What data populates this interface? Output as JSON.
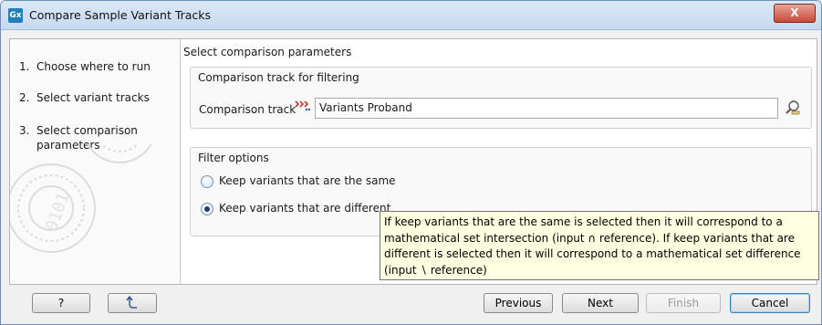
{
  "window": {
    "app_icon_text": "Gx",
    "title": "Compare Sample Variant Tracks",
    "close_symbol": "X"
  },
  "steps": [
    {
      "num": "1.",
      "label": "Choose where to run"
    },
    {
      "num": "2.",
      "label": "Select variant tracks"
    },
    {
      "num": "3.",
      "label": "Select comparison parameters"
    }
  ],
  "content": {
    "section_title": "Select comparison parameters",
    "comparison_group": {
      "title": "Comparison track for filtering",
      "track_label": "Comparison track",
      "track_value": "Variants Proband",
      "track_icon": "variant-track-icon",
      "browse_icon": "browse-magnifier-icon"
    },
    "filter_group": {
      "title": "Filter options",
      "options": [
        {
          "label": "Keep variants that are the same",
          "checked": false
        },
        {
          "label": "Keep variants that are different",
          "checked": true
        }
      ]
    },
    "tooltip_lines": [
      "If keep variants that are the same is selected then it will correspond to a",
      "mathematical set intersection (input ∩ reference). If keep variants that are",
      "different is selected then it will correspond to a mathematical set difference",
      "(input ∖ reference)"
    ]
  },
  "footer": {
    "help_label": "?",
    "reset_icon": "reset-arrow-icon",
    "previous_label": "Previous",
    "next_label": "Next",
    "finish_label": "Finish",
    "cancel_label": "Cancel"
  }
}
